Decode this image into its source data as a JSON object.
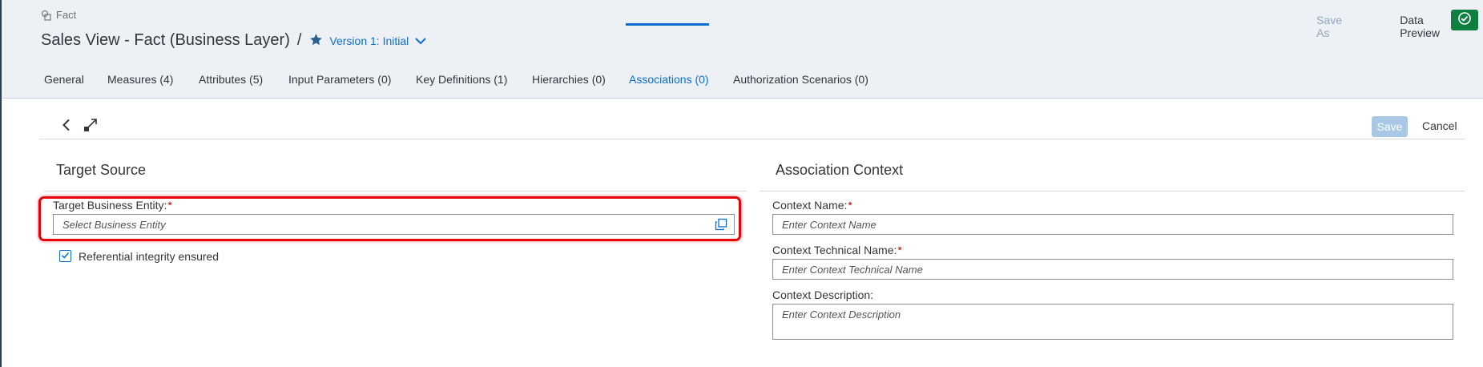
{
  "header": {
    "breadcrumb": "Fact",
    "title": "Sales View - Fact (Business Layer)",
    "separator": "/",
    "version_label": "Version 1: Initial",
    "actions": {
      "save_as": "Save As",
      "data_preview": "Data Preview"
    }
  },
  "tabs": [
    {
      "label": "General"
    },
    {
      "label": "Measures (4)"
    },
    {
      "label": "Attributes (5)"
    },
    {
      "label": "Input Parameters (0)"
    },
    {
      "label": "Key Definitions (1)"
    },
    {
      "label": "Hierarchies (0)"
    },
    {
      "label": "Associations (0)"
    },
    {
      "label": "Authorization Scenarios (0)"
    }
  ],
  "active_tab": "Associations (0)",
  "toolbar": {
    "save_label": "Save",
    "cancel_label": "Cancel"
  },
  "target_source": {
    "title": "Target Source",
    "entity_label": "Target Business Entity:",
    "required_mark": "*",
    "entity_placeholder": "Select Business Entity",
    "referential_label": "Referential integrity ensured",
    "referential_checked": true
  },
  "association_context": {
    "title": "Association Context",
    "name_label": "Context Name:",
    "name_placeholder": "Enter Context Name",
    "technical_label": "Context Technical Name:",
    "technical_placeholder": "Enter Context Technical Name",
    "description_label": "Context Description:",
    "description_placeholder": "Enter Context Description",
    "required_mark": "*"
  },
  "colors": {
    "accent": "#0a6ed1",
    "header_bg": "#edf1f6",
    "success": "#107e3e",
    "highlight": "#e8000b",
    "required": "#bb0000"
  },
  "icons": {
    "breadcrumb": "cube-icon",
    "version": "star-icon",
    "version_toggle": "chevron-down-icon",
    "check": "check-circle-icon",
    "back": "chevron-left-icon",
    "expand": "expand-icon",
    "value_help": "value-help-icon",
    "checkbox": "checkmark-icon"
  }
}
